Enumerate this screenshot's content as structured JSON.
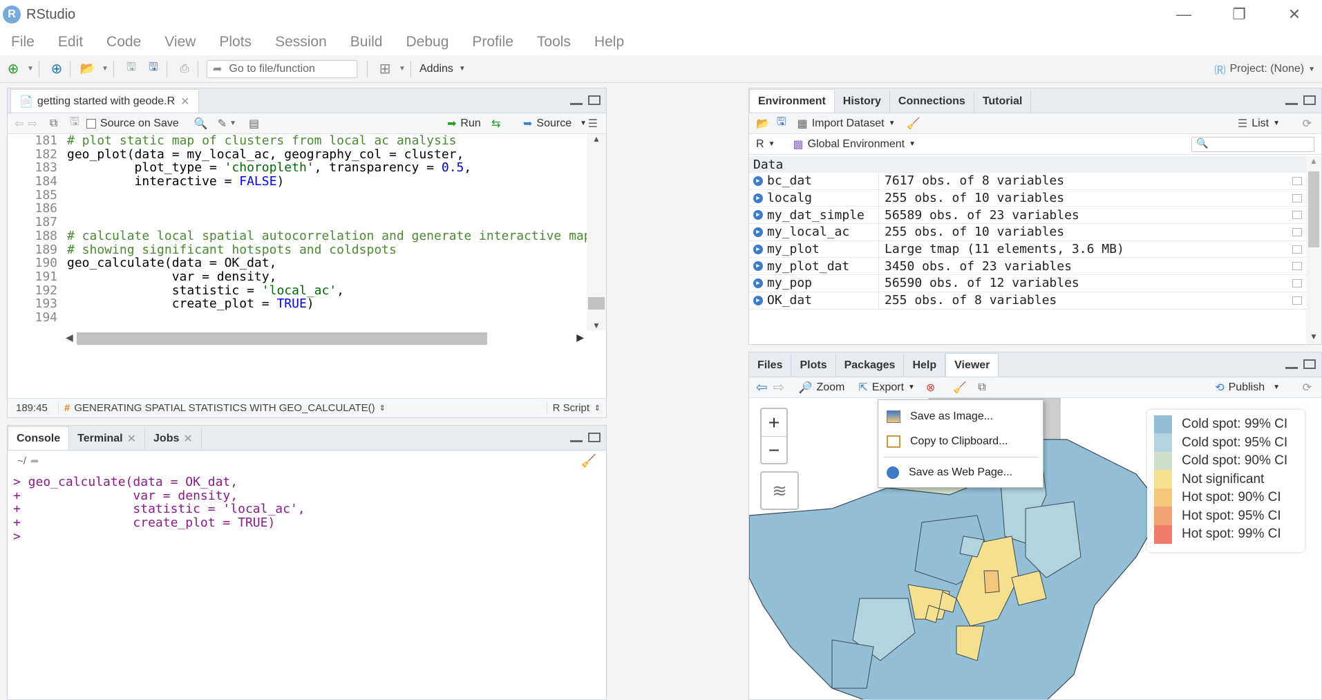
{
  "window": {
    "title": "RStudio",
    "logo": "R"
  },
  "menu": [
    "File",
    "Edit",
    "Code",
    "View",
    "Plots",
    "Session",
    "Build",
    "Debug",
    "Profile",
    "Tools",
    "Help"
  ],
  "toolbar": {
    "goto_placeholder": "Go to file/function",
    "addins": "Addins",
    "project": "Project: (None)"
  },
  "editor": {
    "tab": "getting started with geode.R",
    "source_on_save": "Source on Save",
    "run": "Run",
    "source": "Source",
    "lines": [
      {
        "n": "181",
        "parts": [
          {
            "t": "# plot static map of clusters from local ac analysis",
            "c": "cm"
          }
        ]
      },
      {
        "n": "182",
        "parts": [
          {
            "t": "geo_plot(data = my_local_ac, geography_col = cluster,",
            "c": ""
          }
        ]
      },
      {
        "n": "183",
        "parts": [
          {
            "t": "         plot_type = ",
            "c": ""
          },
          {
            "t": "'choropleth'",
            "c": "st"
          },
          {
            "t": ", transparency = ",
            "c": ""
          },
          {
            "t": "0.5",
            "c": "num"
          },
          {
            "t": ",",
            "c": ""
          }
        ]
      },
      {
        "n": "184",
        "parts": [
          {
            "t": "         interactive = ",
            "c": ""
          },
          {
            "t": "FALSE",
            "c": "kw"
          },
          {
            "t": ")",
            "c": ""
          }
        ]
      },
      {
        "n": "185",
        "parts": []
      },
      {
        "n": "186",
        "parts": []
      },
      {
        "n": "187",
        "parts": []
      },
      {
        "n": "188",
        "parts": [
          {
            "t": "# calculate local spatial autocorrelation and generate interactive map",
            "c": "cm"
          }
        ]
      },
      {
        "n": "189",
        "parts": [
          {
            "t": "# showing significant hotspots and coldspots",
            "c": "cm"
          }
        ]
      },
      {
        "n": "190",
        "parts": [
          {
            "t": "geo_calculate(data = OK_dat,",
            "c": ""
          }
        ]
      },
      {
        "n": "191",
        "parts": [
          {
            "t": "              var = density,",
            "c": ""
          }
        ]
      },
      {
        "n": "192",
        "parts": [
          {
            "t": "              statistic = ",
            "c": ""
          },
          {
            "t": "'local_ac'",
            "c": "st"
          },
          {
            "t": ",",
            "c": ""
          }
        ]
      },
      {
        "n": "193",
        "parts": [
          {
            "t": "              create_plot = ",
            "c": ""
          },
          {
            "t": "TRUE",
            "c": "kw"
          },
          {
            "t": ")",
            "c": ""
          }
        ]
      },
      {
        "n": "194",
        "parts": []
      }
    ],
    "cursor_pos": "189:45",
    "section": "GENERATING SPATIAL STATISTICS WITH GEO_CALCULATE()",
    "file_type": "R Script"
  },
  "console": {
    "tabs": [
      "Console",
      "Terminal",
      "Jobs"
    ],
    "path": "~/",
    "lines": [
      "> geo_calculate(data = OK_dat,",
      "+               var = density,",
      "+               statistic = 'local_ac',",
      "+               create_plot = TRUE)",
      "> "
    ]
  },
  "environment": {
    "tabs": [
      "Environment",
      "History",
      "Connections",
      "Tutorial"
    ],
    "import_dataset": "Import Dataset",
    "list_label": "List",
    "lang": "R",
    "scope": "Global Environment",
    "section": "Data",
    "rows": [
      {
        "name": "bc_dat",
        "value": "7617 obs. of 8 variables"
      },
      {
        "name": "localg",
        "value": "255 obs. of 10 variables"
      },
      {
        "name": "my_dat_simple",
        "value": "56589 obs. of 23 variables"
      },
      {
        "name": "my_local_ac",
        "value": "255 obs. of 10 variables"
      },
      {
        "name": "my_plot",
        "value": "Large tmap (11 elements,  3.6 MB)"
      },
      {
        "name": "my_plot_dat",
        "value": "3450 obs. of 23 variables"
      },
      {
        "name": "my_pop",
        "value": "56590 obs. of 12 variables"
      },
      {
        "name": "OK_dat",
        "value": "255 obs. of 8 variables"
      }
    ]
  },
  "viewer": {
    "tabs": [
      "Files",
      "Plots",
      "Packages",
      "Help",
      "Viewer"
    ],
    "zoom": "Zoom",
    "export": "Export",
    "publish": "Publish",
    "export_menu": [
      "Save as Image...",
      "Copy to Clipboard...",
      "Save as Web Page..."
    ],
    "zoom_in": "+",
    "zoom_out": "−",
    "legend": [
      {
        "label": "Cold spot: 99% CI",
        "color": "#92bfd6"
      },
      {
        "label": "Cold spot: 95% CI",
        "color": "#b3d3df"
      },
      {
        "label": "Cold spot: 90% CI",
        "color": "#cfdfc9"
      },
      {
        "label": "Not significant",
        "color": "#f4e08e"
      },
      {
        "label": "Hot spot: 90% CI",
        "color": "#f4c77a"
      },
      {
        "label": "Hot spot: 95% CI",
        "color": "#f2a474"
      },
      {
        "label": "Hot spot: 99% CI",
        "color": "#ee7b6b"
      }
    ]
  }
}
